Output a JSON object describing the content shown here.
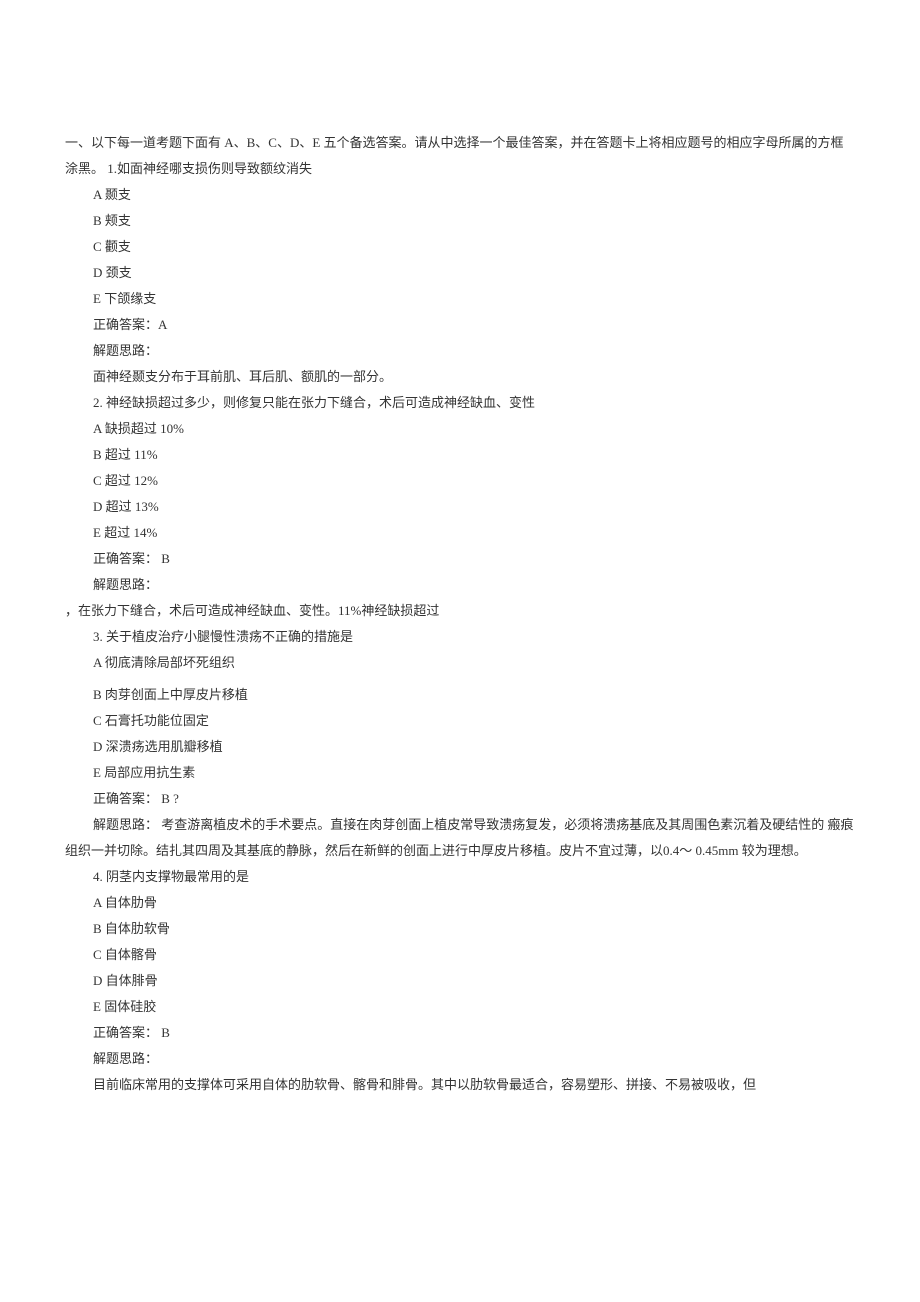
{
  "intro": "一、以下每一道考题下面有 A、B、C、D、E 五个备选答案。请从中选择一个最佳答案，并在答题卡上将相应题号的相应字母所属的方框涂黑。  1.如面神经哪支损伤则导致额纹消失",
  "q1": {
    "opts": [
      "A 颞支",
      "B 颊支",
      "C 颧支",
      "D 颈支",
      "E 下颌缘支"
    ],
    "ans": "正确答案：A",
    "exp_h": "解题思路：",
    "exp": "面神经颞支分布于耳前肌、耳后肌、额肌的一部分。"
  },
  "q2": {
    "stem": "2.  神经缺损超过多少，则修复只能在张力下缝合，术后可造成神经缺血、变性",
    "opts": [
      "A 缺损超过  10%",
      "B 超过  11%",
      "C 超过  12%",
      "D 超过  13%",
      "E 超过  14%"
    ],
    "ans": "正确答案：  B",
    "exp_h": "解题思路：",
    "exp": "，在张力下缝合，术后可造成神经缺血、变性。11%神经缺损超过"
  },
  "q3": {
    "stem": "3.  关于植皮治疗小腿慢性溃疡不正确的措施是",
    "opts": [
      "A 彻底清除局部坏死组织",
      "B 肉芽创面上中厚皮片移植",
      "C 石膏托功能位固定",
      "D 深溃疡选用肌瓣移植",
      "E 局部应用抗生素"
    ],
    "ans": "正确答案：  B ?",
    "exp": "解题思路：  考查游离植皮术的手术要点。直接在肉芽创面上植皮常导致溃疡复发，必须将溃疡基底及其周围色素沉着及硬结性的 瘢痕组织一并切除。结扎其四周及其基底的静脉，然后在新鲜的创面上进行中厚皮片移植。皮片不宜过薄，以0.4～ 0.45mm 较为理想。"
  },
  "q4": {
    "stem": "4.  阴茎内支撑物最常用的是",
    "opts": [
      "A 自体肋骨",
      "B 自体肋软骨",
      "C 自体髂骨",
      "D 自体腓骨",
      "E 固体硅胶"
    ],
    "ans": "正确答案：  B",
    "exp_h": "解题思路：",
    "exp": "目前临床常用的支撑体可采用自体的肋软骨、髂骨和腓骨。其中以肋软骨最适合，容易塑形、拼接、不易被吸收，但"
  }
}
